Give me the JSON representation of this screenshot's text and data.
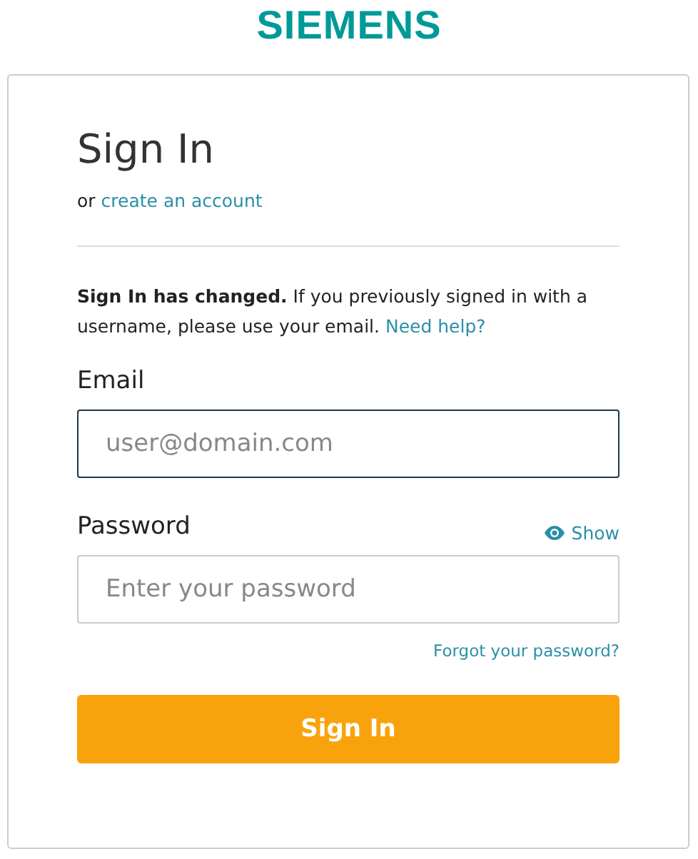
{
  "logo": "SIEMENS",
  "heading": "Sign In",
  "alternative": {
    "prefix": "or",
    "link": "create an account"
  },
  "notice": {
    "text": "**Sign In has changed.** If you previously signed in with a username, please use your email.",
    "link": "Need help?"
  },
  "fields": [
    {
      "label": "Email",
      "placeholder": "user@domain.com",
      "focused": true
    },
    {
      "label": "Password",
      "placeholder": "Enter your password",
      "focused": false,
      "toggle": "Show"
    }
  ],
  "forgot_link": "Forgot your password?",
  "submit": "Sign In"
}
